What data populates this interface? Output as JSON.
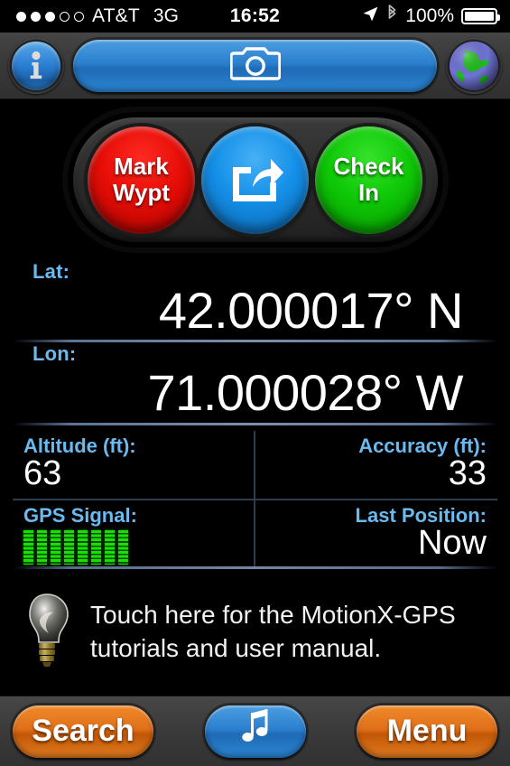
{
  "status_bar": {
    "signal_dots_filled": 3,
    "signal_dots_total": 5,
    "carrier": "AT&T",
    "network": "3G",
    "time": "16:52",
    "location_icon": "location-arrow-icon",
    "bluetooth_icon": "bluetooth-icon",
    "battery_percent": "100%",
    "battery_level": 100
  },
  "top_toolbar": {
    "info_button": {
      "icon": "info-icon",
      "label": "i"
    },
    "camera_button": {
      "icon": "camera-icon"
    },
    "globe_button": {
      "icon": "globe-icon"
    }
  },
  "action_buttons": [
    {
      "id": "mark-waypoint",
      "line1": "Mark",
      "line2": "Wypt",
      "color": "#e60d07"
    },
    {
      "id": "share",
      "icon": "share-icon",
      "color": "#1490e8"
    },
    {
      "id": "check-in",
      "line1": "Check",
      "line2": "In",
      "color": "#0ec806"
    }
  ],
  "coordinates": {
    "lat_label": "Lat:",
    "lat_value": "42.000017° N",
    "lon_label": "Lon:",
    "lon_value": "71.000028° W"
  },
  "data_grid": [
    [
      {
        "label": "Altitude (ft):",
        "value": "63",
        "align": "left"
      },
      {
        "label": "Accuracy (ft):",
        "value": "33",
        "align": "right"
      }
    ],
    [
      {
        "label": "GPS Signal:",
        "value": "",
        "align": "left",
        "bars_filled": 8,
        "bars_total": 8
      },
      {
        "label": "Last Position:",
        "value": "Now",
        "align": "right"
      }
    ]
  ],
  "hint": {
    "icon": "lightbulb-icon",
    "text": "Touch here for the MotionX-GPS tutorials and user manual."
  },
  "bottom_toolbar": {
    "search_label": "Search",
    "music_icon": "music-note-icon",
    "menu_label": "Menu"
  },
  "colors": {
    "label_blue": "#6ab9ef",
    "accent_orange": "#e0701a",
    "accent_blue": "#2b80cf",
    "signal_green": "#18e000",
    "background": "#000000",
    "toolbar_gray": "#3b3b3b"
  }
}
